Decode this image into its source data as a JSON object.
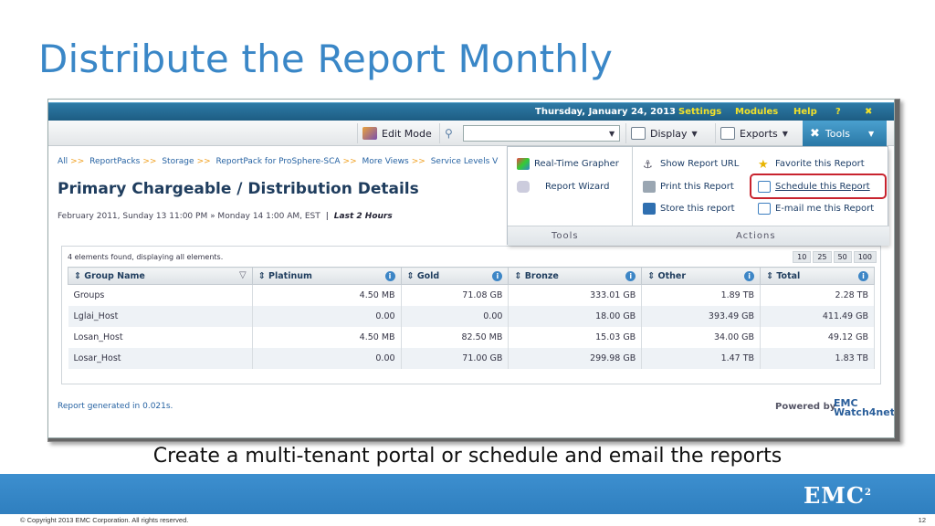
{
  "slide": {
    "title": "Distribute the Report Monthly",
    "caption": "Create a multi-tenant portal or schedule and email the reports",
    "copyright": "© Copyright 2013 EMC Corporation. All rights reserved.",
    "page_number": "12",
    "logo_text": "EMC",
    "logo_sup": "2"
  },
  "app": {
    "topbar": {
      "date": "Thursday, January 24, 2013",
      "links": [
        "Settings",
        "Modules",
        "Help",
        "?"
      ],
      "close": "✖"
    },
    "toolbar": {
      "edit_mode": "Edit Mode",
      "search_value": "",
      "display": "Display",
      "exports": "Exports",
      "tools": "Tools"
    },
    "breadcrumb": [
      "All",
      "ReportPacks",
      "Storage",
      "ReportPack for ProSphere-SCA",
      "More Views",
      "Service Levels V"
    ],
    "page_title": "Primary Chargeable / Distribution Details",
    "time_range": "February 2011, Sunday 13 11:00 PM » Monday 14 1:00 AM, EST",
    "time_window": "Last 2 Hours",
    "tools_menu": {
      "tools_items": [
        "Real-Time Grapher",
        "Report Wizard"
      ],
      "actions_col1": [
        "Show Report URL",
        "Print this Report",
        "Store this report"
      ],
      "actions_col2": [
        "Favorite this Report",
        "Schedule this Report",
        "E-mail me this Report"
      ],
      "tools_label": "Tools",
      "actions_label": "Actions"
    },
    "table": {
      "found_text": "4 elements found, displaying all elements.",
      "page_sizes": [
        "10",
        "25",
        "50",
        "100"
      ],
      "columns": [
        "Group Name",
        "Platinum",
        "Gold",
        "Bronze",
        "Other",
        "Total"
      ],
      "rows": [
        [
          "Groups",
          "4.50 MB",
          "71.08 GB",
          "333.01 GB",
          "1.89 TB",
          "2.28 TB"
        ],
        [
          "Lglai_Host",
          "0.00",
          "0.00",
          "18.00 GB",
          "393.49 GB",
          "411.49 GB"
        ],
        [
          "Losan_Host",
          "4.50 MB",
          "82.50 MB",
          "15.03 GB",
          "34.00 GB",
          "49.12 GB"
        ],
        [
          "Losar_Host",
          "0.00",
          "71.00 GB",
          "299.98 GB",
          "1.47 TB",
          "1.83 TB"
        ]
      ]
    },
    "generated": "Report generated in 0.021s.",
    "powered_by": "Powered by",
    "powered_logo_1": "EMC",
    "powered_logo_2": "Watch4net"
  }
}
